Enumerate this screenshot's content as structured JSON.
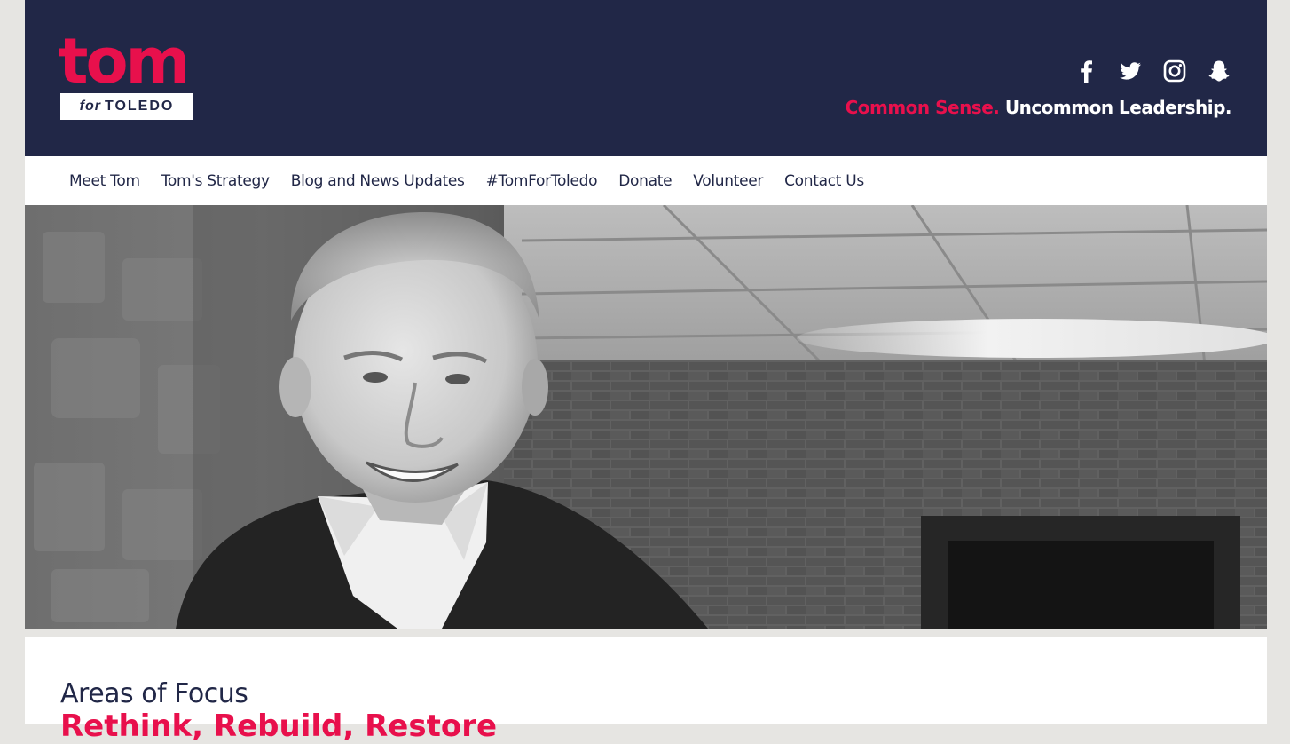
{
  "header": {
    "logo": {
      "word": "tom",
      "for": "for",
      "city": "TOLEDO"
    },
    "social": [
      {
        "icon": "facebook-icon"
      },
      {
        "icon": "twitter-icon"
      },
      {
        "icon": "instagram-icon"
      },
      {
        "icon": "snapchat-icon"
      }
    ],
    "tagline": {
      "accent": "Common Sense.",
      "main": "Uncommon Leadership."
    }
  },
  "nav": {
    "items": [
      {
        "label": "Meet Tom"
      },
      {
        "label": "Tom's Strategy"
      },
      {
        "label": "Blog and News Updates"
      },
      {
        "label": "#TomForToledo"
      },
      {
        "label": "Donate"
      },
      {
        "label": "Volunteer"
      },
      {
        "label": "Contact Us"
      }
    ]
  },
  "content": {
    "heading": "Areas of Focus",
    "subheading": "Rethink, Rebuild, Restore"
  },
  "colors": {
    "navy": "#212747",
    "accent": "#e8104c",
    "page_bg": "#e6e5e2"
  }
}
